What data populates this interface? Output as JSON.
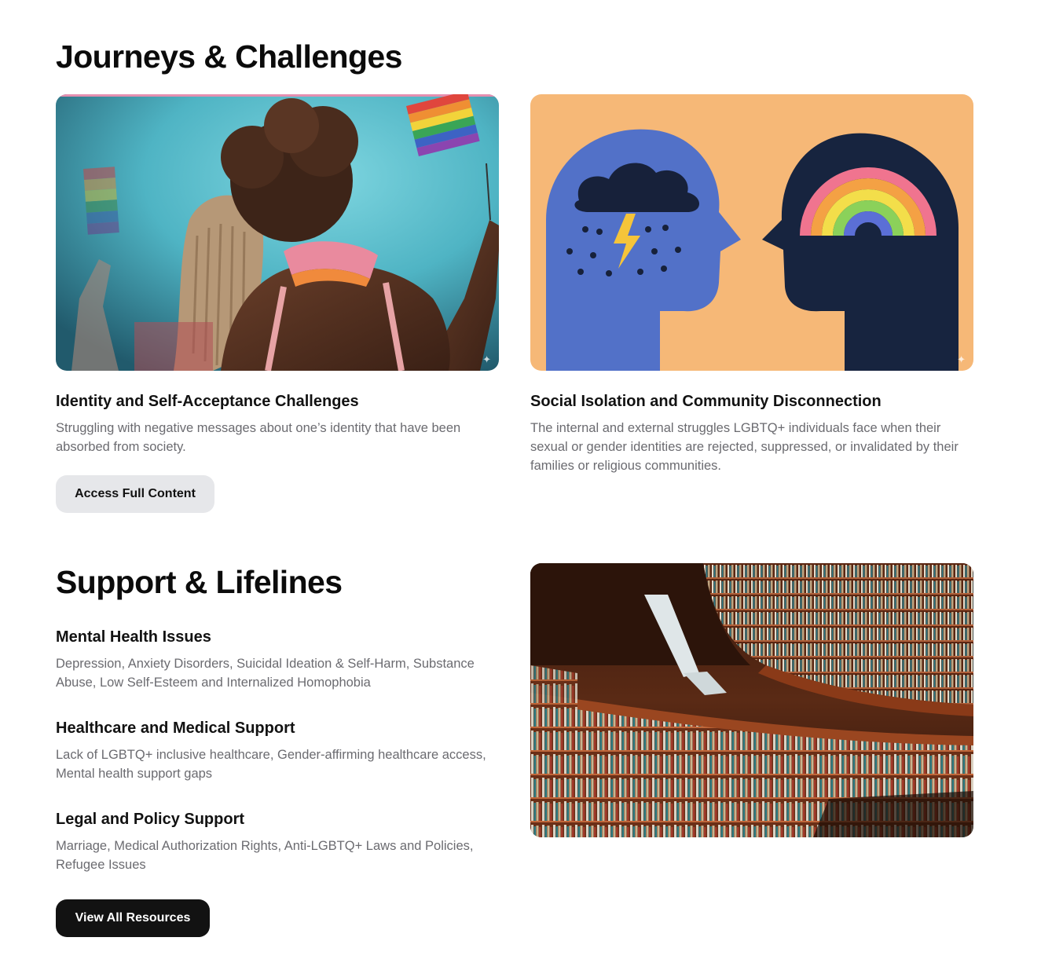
{
  "journeys": {
    "title": "Journeys & Challenges",
    "cards": [
      {
        "title": "Identity and Self-Acceptance Challenges",
        "description": "Struggling with negative messages about one’s identity that have been absorbed from society.",
        "button_label": "Access Full Content"
      },
      {
        "title": "Social Isolation and Community Disconnection",
        "description": "The internal and external struggles LGBTQ+ individuals face when their sexual or gender identities are rejected, suppressed, or invalidated by their families or religious communities."
      }
    ]
  },
  "support": {
    "title": "Support & Lifelines",
    "items": [
      {
        "title": "Mental Health Issues",
        "description": "Depression, Anxiety Disorders, Suicidal Ideation & Self-Harm, Substance Abuse, Low Self-Esteem and Internalized Homophobia"
      },
      {
        "title": "Healthcare and Medical Support",
        "description": "Lack of LGBTQ+ inclusive healthcare, Gender-affirming healthcare access, Mental health support gaps"
      },
      {
        "title": "Legal and Policy Support",
        "description": "Marriage, Medical Authorization Rights, Anti-LGBTQ+ Laws and Policies, Refugee Issues"
      }
    ],
    "button_label": "View All Resources"
  },
  "icons": {
    "sparkle": "sparkle-icon"
  },
  "colors": {
    "primary_button": "#121212",
    "secondary_button": "#e6e7ea",
    "muted_text": "#6b6b70",
    "illustration_background": "#f6b877"
  }
}
